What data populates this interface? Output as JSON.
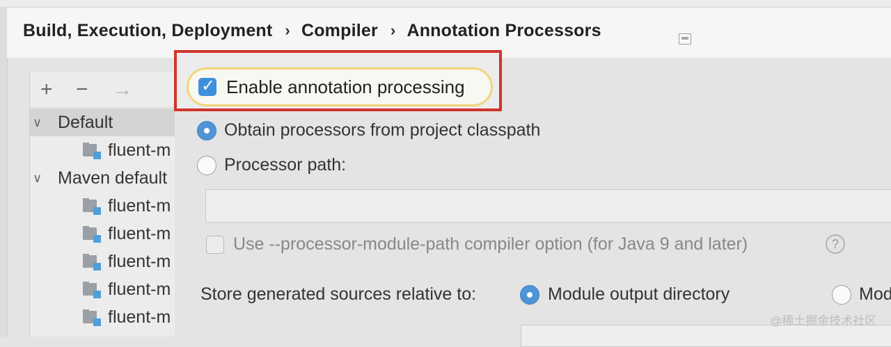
{
  "breadcrumb": {
    "items": [
      "Build, Execution, Deployment",
      "Compiler",
      "Annotation Processors"
    ],
    "separator": "›"
  },
  "toolbar": {
    "add": "+",
    "remove": "−",
    "move": "→"
  },
  "tree": {
    "groups": [
      {
        "label": "Default",
        "expanded": true,
        "selected": true,
        "modules": [
          "fluent-m"
        ]
      },
      {
        "label": "Maven default",
        "expanded": true,
        "selected": false,
        "modules": [
          "fluent-m",
          "fluent-m",
          "fluent-m",
          "fluent-m",
          "fluent-m"
        ]
      }
    ]
  },
  "options": {
    "enable_annotation_processing": {
      "label": "Enable annotation processing",
      "checked": true
    },
    "obtain_from_classpath": {
      "label": "Obtain processors from project classpath",
      "selected": true
    },
    "processor_path": {
      "label": "Processor path:",
      "selected": false,
      "value": ""
    },
    "use_module_path": {
      "label": "Use --processor-module-path compiler option (for Java 9 and later)",
      "checked": false,
      "help": "?"
    },
    "store_generated": {
      "label": "Store generated sources relative to:",
      "choices": [
        {
          "label": "Module output directory",
          "selected": true
        },
        {
          "label": "Mod",
          "selected": false
        }
      ]
    }
  },
  "watermark": "@稀土掘金技术社区",
  "colors": {
    "highlight": "#d0342c",
    "accent": "#3d8fdc",
    "focus": "#f2d57a"
  }
}
